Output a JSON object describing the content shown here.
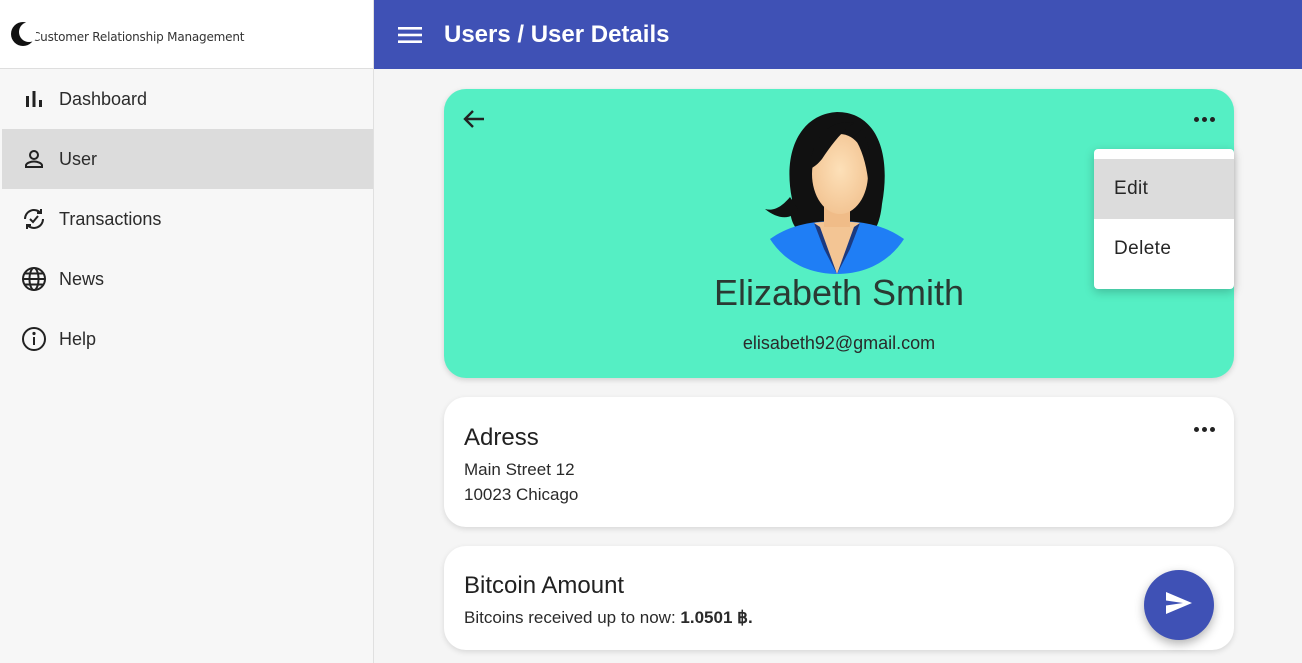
{
  "app": {
    "logo_text": "Customer Relationship Management"
  },
  "header": {
    "title": "Users / User Details"
  },
  "sidebar": {
    "items": [
      {
        "label": "Dashboard",
        "icon": "bar-chart-icon"
      },
      {
        "label": "User",
        "icon": "person-icon",
        "active": true
      },
      {
        "label": "Transactions",
        "icon": "sync-check-icon"
      },
      {
        "label": "News",
        "icon": "globe-icon"
      },
      {
        "label": "Help",
        "icon": "info-icon"
      }
    ]
  },
  "profile": {
    "name": "Elizabeth Smith",
    "email": "elisabeth92@gmail.com",
    "background_color": "#55efc4"
  },
  "context_menu": {
    "items": [
      {
        "label": "Edit"
      },
      {
        "label": "Delete"
      }
    ]
  },
  "address": {
    "title": "Adress",
    "line1": "Main Street 12",
    "line2": "10023 Chicago"
  },
  "bitcoin": {
    "title": "Bitcoin Amount",
    "text_prefix": "Bitcoins received up to now: ",
    "amount": "1.0501 ฿."
  },
  "colors": {
    "primary": "#3f51b5",
    "accent": "#55efc4"
  }
}
